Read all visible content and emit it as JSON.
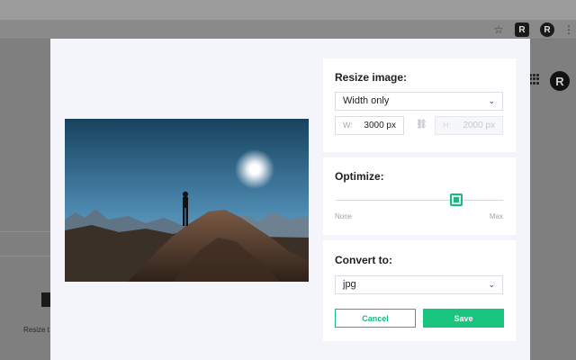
{
  "browser": {
    "star_icon": "☆",
    "ext_badge": "R",
    "profile_letter": "R",
    "menu_icon": "⋮"
  },
  "background": {
    "avatar_letter": "R",
    "caption": "Resize t"
  },
  "modal": {
    "resize": {
      "title": "Resize image:",
      "mode_selected": "Width only",
      "width_label": "W:",
      "width_value": "3000 px",
      "height_label": "H:",
      "height_value": "2000 px",
      "link_icon": "⛓"
    },
    "optimize": {
      "title": "Optimize:",
      "min_label": "None",
      "max_label": "Max",
      "level_percent": 72
    },
    "convert": {
      "title": "Convert to:",
      "format_selected": "jpg",
      "cancel_label": "Cancel",
      "save_label": "Save"
    }
  },
  "colors": {
    "accent": "#19c57e",
    "sky_top": "#1d4a6e",
    "sky_bottom": "#6fa6c7"
  }
}
